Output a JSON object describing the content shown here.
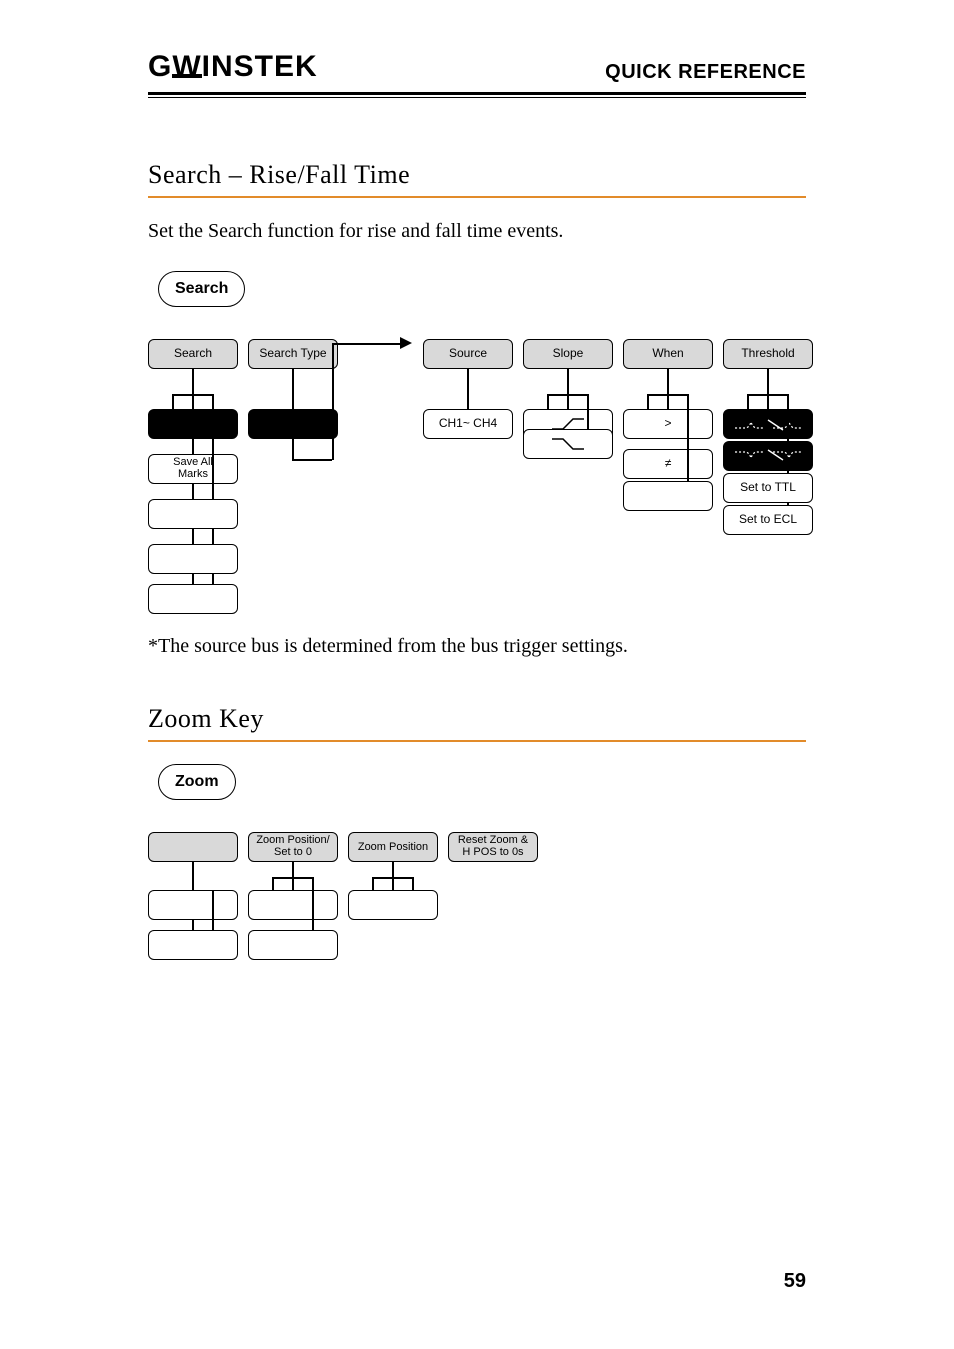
{
  "header": {
    "brand": "GWINSTEK",
    "section_label": "QUICK REFERENCE"
  },
  "page_number": "59",
  "search_section": {
    "title": "Search – Rise/Fall Time",
    "intro": "Set the Search function for rise and fall time events.",
    "key_label": "Search",
    "menu": {
      "col_search": {
        "top": "Search",
        "save_all_marks": "Save All\nMarks"
      },
      "col_type": {
        "top": "Search Type"
      },
      "col_source": {
        "top": "Source",
        "opt1": "CH1~ CH4"
      },
      "col_slope": {
        "top": "Slope"
      },
      "col_when": {
        "top": "When",
        "opt_gt": ">",
        "opt_ne": "≠"
      },
      "col_thresh": {
        "top": "Threshold",
        "set_ttl": "Set to TTL",
        "set_ecl": "Set to ECL"
      }
    },
    "footnote": "*The source bus is determined from the bus trigger settings."
  },
  "zoom_section": {
    "title": "Zoom Key",
    "key_label": "Zoom",
    "menu": {
      "col2": "Zoom Position/\nSet to 0",
      "col3": "Zoom Position",
      "col4": "Reset Zoom &\nH POS to 0s"
    }
  }
}
